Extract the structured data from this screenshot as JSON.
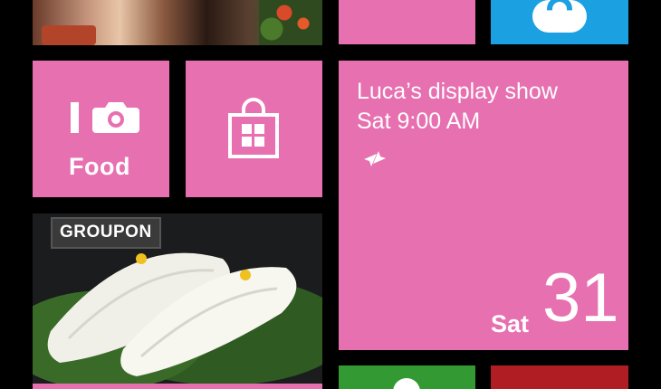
{
  "tiles": {
    "ifood": {
      "label": "Food",
      "icon": "camera-icon"
    },
    "store": {
      "icon": "shopping-bag-icon"
    },
    "calendar": {
      "event_title": "Luca’s display show",
      "event_time": "Sat 9:00 AM",
      "day_name": "Sat",
      "date": "31",
      "icon": "reminder-arrows-icon"
    },
    "groupon": {
      "badge": "GROUPON"
    },
    "skype": {
      "icon": "skype-icon"
    }
  },
  "colors": {
    "accent_pink": "#e770b1",
    "skype_blue": "#1ba1e2",
    "green": "#339933",
    "red": "#b01e23",
    "background": "#000000"
  }
}
